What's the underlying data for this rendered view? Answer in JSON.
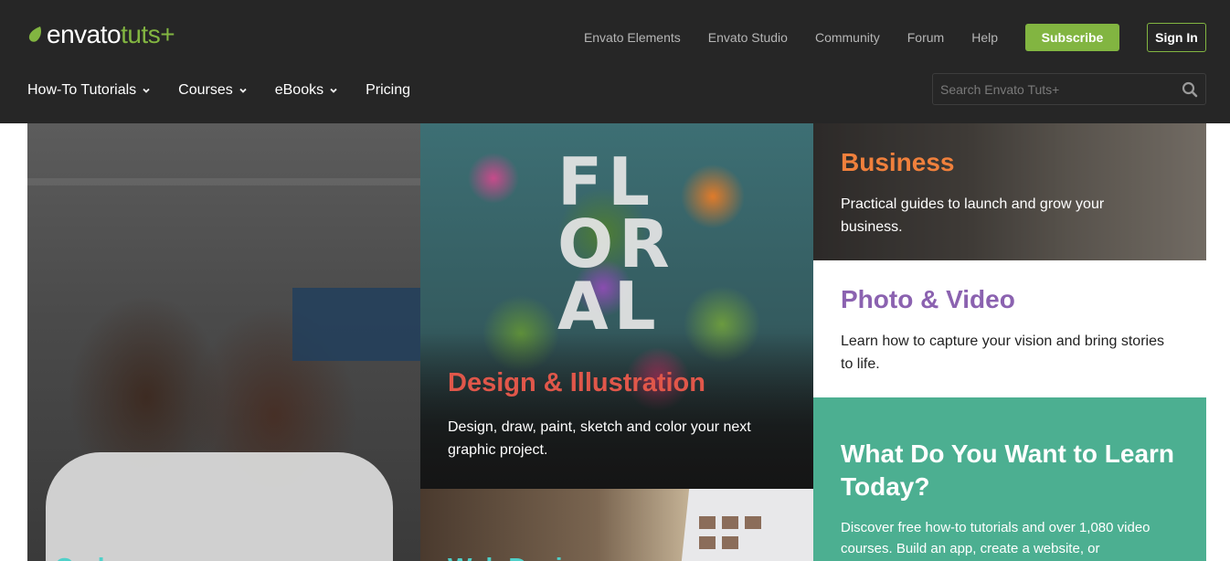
{
  "brand": {
    "logo_word": "envato",
    "logo_tuts": "tuts+",
    "accent_color": "#82b541",
    "header_bg": "#262626"
  },
  "topnav": {
    "links": [
      "Envato Elements",
      "Envato Studio",
      "Community",
      "Forum",
      "Help"
    ],
    "subscribe_label": "Subscribe",
    "signin_label": "Sign In"
  },
  "mainnav": {
    "items": [
      {
        "label": "How-To Tutorials",
        "icon": "chevron-down-icon"
      },
      {
        "label": "Courses",
        "icon": "chevron-down-icon"
      },
      {
        "label": "eBooks",
        "icon": "chevron-down-icon"
      },
      {
        "label": "Pricing"
      }
    ]
  },
  "search": {
    "placeholder": "Search Envato Tuts+",
    "value": "",
    "icon": "search-icon"
  },
  "tiles": {
    "code": {
      "title": "Code",
      "color": "#4fd0c9"
    },
    "design": {
      "letters": "FLORAL",
      "title": "Design & Illustration",
      "description": "Design, draw, paint, sketch and color your next graphic project.",
      "color": "#e0574a"
    },
    "web": {
      "title": "Web Design",
      "color": "#4fd0c9"
    },
    "business": {
      "title": "Business",
      "description": "Practical guides to launch and grow your business.",
      "color": "#f0803c"
    },
    "photo": {
      "title": "Photo & Video",
      "description": "Learn how to capture your vision and bring stories to life.",
      "color": "#8b62b0"
    },
    "learn": {
      "title": "What Do You Want to Learn Today?",
      "description": "Discover free how-to tutorials and over 1,080 video courses. Build an app, create a website, or",
      "color": "#4caf91"
    }
  }
}
